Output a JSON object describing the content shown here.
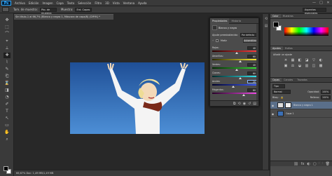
{
  "app": {
    "logo": "Ps"
  },
  "menu": [
    "Archivo",
    "Edición",
    "Imagen",
    "Capa",
    "Texto",
    "Selección",
    "Filtro",
    "3D",
    "Vista",
    "Ventana",
    "Ayuda"
  ],
  "window_controls": [
    "—",
    "□",
    "✕"
  ],
  "options_bar": {
    "size_label": "Tam. de muestra:",
    "size_value": "Pto. de muestra",
    "sample_label": "Muestra:",
    "sample_value": "Ent. Capas",
    "workspace": "Aspectos esenciales"
  },
  "document": {
    "tab_title": "Sin título-1 al 66,7% (Blanco y negro 1, Máscara de capa/8) (CMYK) *",
    "status": "66,67%   Doc: 1,49 MB/1,49 MB"
  },
  "properties": {
    "tabs": [
      "Propiedades",
      "Historia"
    ],
    "title": "Blanco y negro",
    "preset_label": "Ajuste preestablecido:",
    "preset_value": "Por defecto",
    "tint_label": "Matiz",
    "auto_label": "Automático",
    "sliders": [
      {
        "label": "Rojos:",
        "value": "40",
        "position": 0.55,
        "gradient": [
          "#2a0000",
          "#ff3b3b"
        ]
      },
      {
        "label": "Amarillos:",
        "value": "60",
        "position": 0.62,
        "gradient": [
          "#2a2a00",
          "#ffee33"
        ]
      },
      {
        "label": "Verdes:",
        "value": "40",
        "position": 0.55,
        "gradient": [
          "#002a00",
          "#33dd33"
        ]
      },
      {
        "label": "Cianes:",
        "value": "60",
        "position": 0.62,
        "gradient": [
          "#002a2a",
          "#33e6f0"
        ]
      },
      {
        "label": "Azules:",
        "value": "20",
        "position": 0.47,
        "gradient": [
          "#00002a",
          "#3b5bff"
        ]
      },
      {
        "label": "Magentas:",
        "value": "80",
        "position": 0.7,
        "gradient": [
          "#2a002a",
          "#f04be6"
        ]
      }
    ],
    "footer_icons": [
      "⧉",
      "⟲",
      "◉",
      "↺",
      "▤"
    ]
  },
  "right_panel": {
    "color_tabs": [
      "Color",
      "Muestras"
    ],
    "adjust_tabs": [
      "Ajustes",
      "Estilos"
    ],
    "adjust_title": "Añadir un ajuste",
    "adjust_icons": [
      "☀",
      "▦",
      "◧",
      "◪",
      "▽",
      "◐",
      "▣",
      "⚖",
      "◒",
      "▥",
      "◫",
      "▩"
    ],
    "layers_tabs": [
      "Capas",
      "Canales",
      "Trazados"
    ],
    "kind_value": "Tipo",
    "blend_mode": "Normal",
    "opacity_label": "Opacidad:",
    "opacity_value": "100%",
    "lock_label": "Bloq.:",
    "fill_label": "Relleno:",
    "fill_value": "100%",
    "layers": [
      {
        "name": "Blanco y negro 1",
        "selected": true
      },
      {
        "name": "Capa 1",
        "selected": false
      }
    ],
    "footer_icons": [
      "⛓",
      "fx",
      "◐",
      "▢",
      "🗀",
      "🗑"
    ]
  },
  "tools": [
    "✥",
    "⬚",
    "⌒",
    "⌖",
    "⟂",
    "✚",
    "⌇",
    "✎",
    "⎗",
    "⌛",
    "◨",
    "◔",
    "✐",
    "T",
    "↖",
    "▭",
    "✋",
    "⌕"
  ]
}
